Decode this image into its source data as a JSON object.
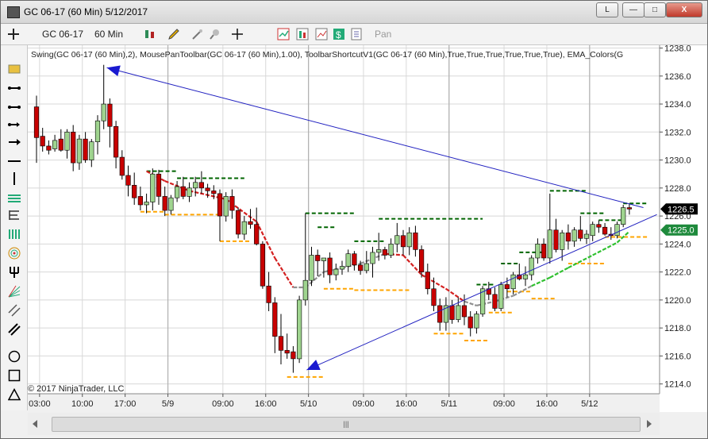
{
  "window": {
    "title": "GC 06-17 (60 Min)  5/12/2017",
    "btn_restore": "L",
    "btn_min": "—",
    "btn_max": "□",
    "btn_close": "X"
  },
  "toolbar": {
    "instrument": "GC 06-17",
    "interval": "60 Min",
    "pan_label": "Pan"
  },
  "chart_data": {
    "type": "candlestick",
    "indicator_label": "Swing(GC 06-17 (60 Min),2), MousePanToolbar(GC 06-17 (60 Min),1.00), ToolbarShortcutV1(GC 06-17 (60 Min),True,True,True,True,True,True), EMA_Colors(G",
    "copyright": "© 2017 NinjaTrader, LLC",
    "ylim": [
      1213.3,
      1238.2
    ],
    "y_ticks": [
      "1238.0",
      "1236.0",
      "1234.0",
      "1232.0",
      "1230.0",
      "1228.0",
      "1226.0",
      "1224.0",
      "1222.0",
      "1220.0",
      "1218.0",
      "1216.0",
      "1214.0"
    ],
    "x_ticks": [
      {
        "label": "03:00",
        "bar": 0.5
      },
      {
        "label": "10:00",
        "bar": 7.5
      },
      {
        "label": "17:00",
        "bar": 14.5
      },
      {
        "label": "5/9",
        "bar": 21.5
      },
      {
        "label": "09:00",
        "bar": 30.5
      },
      {
        "label": "16:00",
        "bar": 37.5
      },
      {
        "label": "5/10",
        "bar": 44.5
      },
      {
        "label": "09:00",
        "bar": 53.5
      },
      {
        "label": "16:00",
        "bar": 60.5
      },
      {
        "label": "5/11",
        "bar": 67.5
      },
      {
        "label": "09:00",
        "bar": 76.5
      },
      {
        "label": "16:00",
        "bar": 83.5
      },
      {
        "label": "5/12",
        "bar": 90.5
      }
    ],
    "day_separators": [
      21.5,
      44.5,
      67.5,
      90.5
    ],
    "candles": [
      [
        1233.8,
        1234.6,
        1229.8,
        1231.6
      ],
      [
        1231.7,
        1232.3,
        1230.6,
        1231.0
      ],
      [
        1231.0,
        1231.4,
        1230.4,
        1230.7
      ],
      [
        1230.8,
        1231.8,
        1230.6,
        1231.4
      ],
      [
        1231.5,
        1232.2,
        1230.6,
        1230.7
      ],
      [
        1230.7,
        1232.2,
        1230.1,
        1232.0
      ],
      [
        1232.0,
        1232.5,
        1229.2,
        1229.8
      ],
      [
        1229.8,
        1231.8,
        1229.3,
        1231.5
      ],
      [
        1231.5,
        1232.0,
        1229.8,
        1230.0
      ],
      [
        1230.0,
        1231.5,
        1229.5,
        1231.3
      ],
      [
        1231.3,
        1233.2,
        1230.4,
        1232.8
      ],
      [
        1232.8,
        1236.8,
        1232.2,
        1234.0
      ],
      [
        1234.0,
        1234.4,
        1230.9,
        1232.4
      ],
      [
        1232.4,
        1232.8,
        1229.4,
        1230.2
      ],
      [
        1230.2,
        1230.7,
        1228.6,
        1228.9
      ],
      [
        1228.9,
        1229.6,
        1227.4,
        1228.2
      ],
      [
        1228.2,
        1229.1,
        1226.8,
        1227.3
      ],
      [
        1227.4,
        1228.1,
        1226.4,
        1226.8
      ],
      [
        1226.8,
        1227.6,
        1226.2,
        1227.0
      ],
      [
        1227.0,
        1229.4,
        1226.4,
        1229.0
      ],
      [
        1229.0,
        1229.3,
        1226.8,
        1227.4
      ],
      [
        1227.4,
        1228.1,
        1226.0,
        1226.4
      ],
      [
        1226.4,
        1227.5,
        1226.1,
        1227.3
      ],
      [
        1227.3,
        1228.5,
        1227.0,
        1228.1
      ],
      [
        1228.1,
        1228.8,
        1227.2,
        1227.4
      ],
      [
        1227.4,
        1228.4,
        1227.0,
        1228.0
      ],
      [
        1228.0,
        1228.8,
        1227.4,
        1228.4
      ],
      [
        1228.4,
        1229.2,
        1227.6,
        1228.0
      ],
      [
        1228.0,
        1228.3,
        1227.3,
        1227.8
      ],
      [
        1227.8,
        1228.2,
        1227.2,
        1227.6
      ],
      [
        1227.6,
        1227.9,
        1224.2,
        1226.0
      ],
      [
        1226.0,
        1227.7,
        1225.6,
        1227.4
      ],
      [
        1227.4,
        1227.9,
        1225.8,
        1226.4
      ],
      [
        1226.4,
        1226.6,
        1224.4,
        1224.7
      ],
      [
        1224.7,
        1226.0,
        1224.3,
        1225.6
      ],
      [
        1225.6,
        1226.5,
        1225.1,
        1225.4
      ],
      [
        1225.4,
        1226.6,
        1223.9,
        1224.0
      ],
      [
        1224.0,
        1224.2,
        1220.8,
        1221.0
      ],
      [
        1221.0,
        1222.0,
        1219.2,
        1219.8
      ],
      [
        1219.8,
        1220.2,
        1216.2,
        1217.4
      ],
      [
        1217.4,
        1219.0,
        1215.4,
        1216.4
      ],
      [
        1216.4,
        1217.6,
        1215.8,
        1216.2
      ],
      [
        1216.3,
        1216.7,
        1214.8,
        1215.8
      ],
      [
        1215.8,
        1220.3,
        1215.5,
        1220.0
      ],
      [
        1220.0,
        1226.2,
        1219.6,
        1221.4
      ],
      [
        1221.4,
        1223.8,
        1221.0,
        1223.2
      ],
      [
        1223.2,
        1223.6,
        1221.7,
        1222.8
      ],
      [
        1222.8,
        1222.8,
        1221.6,
        1223.0
      ],
      [
        1223.0,
        1223.4,
        1221.2,
        1221.8
      ],
      [
        1221.8,
        1222.6,
        1221.4,
        1222.2
      ],
      [
        1222.2,
        1222.8,
        1221.8,
        1222.4
      ],
      [
        1222.4,
        1223.6,
        1222.0,
        1223.3
      ],
      [
        1223.3,
        1223.5,
        1222.1,
        1222.5
      ],
      [
        1222.5,
        1222.8,
        1221.8,
        1222.1
      ],
      [
        1222.1,
        1223.5,
        1221.9,
        1222.6
      ],
      [
        1222.6,
        1223.8,
        1221.6,
        1223.4
      ],
      [
        1223.4,
        1224.8,
        1222.8,
        1223.6
      ],
      [
        1223.6,
        1223.8,
        1222.9,
        1223.2
      ],
      [
        1223.2,
        1224.4,
        1223.0,
        1224.0
      ],
      [
        1224.0,
        1225.5,
        1223.4,
        1224.6
      ],
      [
        1224.6,
        1225.0,
        1223.2,
        1223.8
      ],
      [
        1223.8,
        1225.2,
        1223.2,
        1224.8
      ],
      [
        1224.8,
        1225.3,
        1223.1,
        1223.6
      ],
      [
        1223.6,
        1223.9,
        1221.6,
        1222.0
      ],
      [
        1222.0,
        1222.6,
        1220.4,
        1220.8
      ],
      [
        1220.8,
        1221.6,
        1219.2,
        1219.6
      ],
      [
        1219.6,
        1220.1,
        1217.8,
        1218.4
      ],
      [
        1218.4,
        1220.2,
        1217.8,
        1219.6
      ],
      [
        1219.6,
        1220.0,
        1218.3,
        1218.6
      ],
      [
        1218.6,
        1220.2,
        1218.4,
        1219.6
      ],
      [
        1219.6,
        1220.4,
        1218.2,
        1218.8
      ],
      [
        1218.8,
        1219.2,
        1217.4,
        1218.0
      ],
      [
        1218.0,
        1219.2,
        1217.6,
        1219.0
      ],
      [
        1219.0,
        1221.0,
        1218.8,
        1220.8
      ],
      [
        1220.8,
        1221.3,
        1220.0,
        1220.4
      ],
      [
        1220.4,
        1220.9,
        1219.2,
        1219.4
      ],
      [
        1219.4,
        1221.3,
        1219.2,
        1221.1
      ],
      [
        1221.1,
        1221.6,
        1220.2,
        1220.8
      ],
      [
        1220.8,
        1222.0,
        1220.4,
        1221.8
      ],
      [
        1221.8,
        1222.6,
        1221.4,
        1221.5
      ],
      [
        1221.5,
        1222.4,
        1221.0,
        1221.8
      ],
      [
        1221.8,
        1223.2,
        1221.4,
        1223.0
      ],
      [
        1223.0,
        1224.4,
        1222.6,
        1224.0
      ],
      [
        1224.0,
        1224.4,
        1222.8,
        1223.0
      ],
      [
        1223.0,
        1227.6,
        1222.6,
        1225.0
      ],
      [
        1225.0,
        1225.8,
        1223.4,
        1223.6
      ],
      [
        1223.6,
        1225.0,
        1222.8,
        1224.8
      ],
      [
        1224.8,
        1225.4,
        1223.6,
        1224.2
      ],
      [
        1224.2,
        1225.2,
        1223.8,
        1225.0
      ],
      [
        1225.0,
        1226.0,
        1224.2,
        1224.4
      ],
      [
        1224.4,
        1225.0,
        1224.0,
        1224.7
      ],
      [
        1224.6,
        1225.6,
        1224.2,
        1225.4
      ],
      [
        1225.4,
        1225.7,
        1224.8,
        1225.2
      ],
      [
        1225.2,
        1225.5,
        1224.6,
        1224.7
      ],
      [
        1224.7,
        1225.2,
        1224.3,
        1224.6
      ],
      [
        1224.6,
        1225.6,
        1224.4,
        1225.4
      ],
      [
        1225.4,
        1226.8,
        1225.2,
        1226.6
      ],
      [
        1226.6,
        1226.9,
        1226.1,
        1226.5
      ]
    ],
    "swing_highs": [
      {
        "price": 1229.2,
        "from": 18,
        "to": 23
      },
      {
        "price": 1228.7,
        "from": 23,
        "to": 34
      },
      {
        "price": 1226.2,
        "from": 44,
        "to": 52
      },
      {
        "price": 1225.2,
        "from": 46,
        "to": 49
      },
      {
        "price": 1224.2,
        "from": 52,
        "to": 57
      },
      {
        "price": 1225.8,
        "from": 56,
        "to": 73
      },
      {
        "price": 1221.1,
        "from": 72,
        "to": 75
      },
      {
        "price": 1222.6,
        "from": 76,
        "to": 79
      },
      {
        "price": 1223.4,
        "from": 79,
        "to": 83
      },
      {
        "price": 1227.8,
        "from": 84,
        "to": 90
      },
      {
        "price": 1226.2,
        "from": 89,
        "to": 93
      },
      {
        "price": 1225.7,
        "from": 92,
        "to": 96
      },
      {
        "price": 1226.9,
        "from": 96,
        "to": 100
      }
    ],
    "swing_lows": [
      {
        "price": 1226.3,
        "from": 17,
        "to": 21
      },
      {
        "price": 1226.1,
        "from": 21,
        "to": 30
      },
      {
        "price": 1224.2,
        "from": 30,
        "to": 35
      },
      {
        "price": 1214.5,
        "from": 41,
        "to": 47
      },
      {
        "price": 1220.8,
        "from": 47,
        "to": 52
      },
      {
        "price": 1220.7,
        "from": 52,
        "to": 61
      },
      {
        "price": 1217.6,
        "from": 65,
        "to": 70
      },
      {
        "price": 1217.1,
        "from": 70,
        "to": 74
      },
      {
        "price": 1219.1,
        "from": 74,
        "to": 78
      },
      {
        "price": 1220.6,
        "from": 77,
        "to": 81
      },
      {
        "price": 1220.1,
        "from": 81,
        "to": 85
      },
      {
        "price": 1222.6,
        "from": 87,
        "to": 93
      },
      {
        "price": 1224.5,
        "from": 93,
        "to": 100
      }
    ],
    "ema": [
      [
        18,
        1229.2,
        "red"
      ],
      [
        21,
        1228.5,
        "red"
      ],
      [
        25,
        1227.8,
        "red"
      ],
      [
        31,
        1227.2,
        "red"
      ],
      [
        36,
        1225.6,
        "red"
      ],
      [
        39,
        1223.0,
        "red"
      ],
      [
        42,
        1220.9,
        "red"
      ],
      [
        44,
        1220.9,
        "gray"
      ],
      [
        47,
        1222.0,
        "gray"
      ],
      [
        50,
        1222.3,
        "gray"
      ],
      [
        53,
        1222.6,
        "gray"
      ],
      [
        57,
        1223.3,
        "gray"
      ],
      [
        60,
        1223.2,
        "red"
      ],
      [
        63,
        1221.8,
        "red"
      ],
      [
        67,
        1220.8,
        "red"
      ],
      [
        70,
        1219.9,
        "red"
      ],
      [
        72,
        1219.6,
        "gray"
      ],
      [
        75,
        1219.9,
        "gray"
      ],
      [
        78,
        1220.3,
        "gray"
      ],
      [
        81,
        1221.0,
        "gray"
      ],
      [
        84,
        1221.6,
        "green"
      ],
      [
        87,
        1222.3,
        "green"
      ],
      [
        91,
        1223.2,
        "green"
      ],
      [
        95,
        1224.1,
        "green"
      ],
      [
        97,
        1224.9,
        "green"
      ]
    ],
    "trendlines": [
      {
        "from_bar": 11.5,
        "from_price": 1236.6,
        "to_bar": 99.3,
        "to_price": 1226.6,
        "arrow_at": "start"
      },
      {
        "from_bar": 44.2,
        "from_price": 1215.0,
        "to_bar": 101.5,
        "to_price": 1226.1,
        "arrow_at": "start"
      }
    ],
    "price_markers": [
      {
        "label": "1226.5",
        "price": 1226.5,
        "color": "#000000"
      },
      {
        "label": "1225.0",
        "price": 1225.0,
        "color": "#1e8a3c"
      }
    ],
    "colors": {
      "up": "#9fd48f",
      "down": "#c80000",
      "swing_high": "#006400",
      "swing_low": "#ffa500",
      "trendline": "#2020c0",
      "grid": "#d8d8d8"
    }
  }
}
